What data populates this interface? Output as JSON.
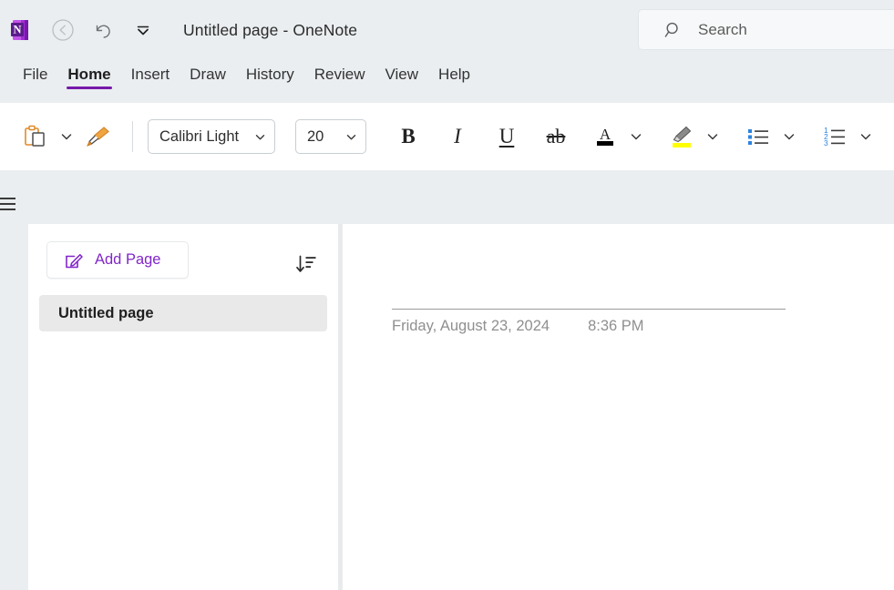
{
  "titlebar": {
    "logo_icon": "onenote-logo-icon",
    "back_icon": "back-arrow-icon",
    "undo_icon": "undo-icon",
    "qat_icon": "customize-quick-access-toolbar-icon",
    "document_name": "Untitled page",
    "separator": "-",
    "app_name": "OneNote"
  },
  "search": {
    "icon": "search-icon",
    "placeholder": "Search",
    "value": ""
  },
  "ribbon": {
    "tabs": [
      {
        "label": "File",
        "active": false
      },
      {
        "label": "Home",
        "active": true
      },
      {
        "label": "Insert",
        "active": false
      },
      {
        "label": "Draw",
        "active": false
      },
      {
        "label": "History",
        "active": false
      },
      {
        "label": "Review",
        "active": false
      },
      {
        "label": "View",
        "active": false
      },
      {
        "label": "Help",
        "active": false
      }
    ],
    "active_accent": "#7719aa"
  },
  "toolbar": {
    "paste_icon": "paste-clipboard-icon",
    "paste_caret_icon": "chevron-down-icon",
    "format_painter_icon": "format-painter-icon",
    "font_name": "Calibri Light",
    "font_name_caret_icon": "chevron-down-icon",
    "font_size": "20",
    "font_size_caret_icon": "chevron-down-icon",
    "bold_label": "B",
    "italic_label": "I",
    "underline_label": "U",
    "strikethrough_label": "ab",
    "font_color_icon": "font-color-icon",
    "font_color_swatch": "#000000",
    "font_color_caret_icon": "chevron-down-icon",
    "highlight_icon": "text-highlight-icon",
    "highlight_swatch": "#ffff00",
    "highlight_caret_icon": "chevron-down-icon",
    "bullets_icon": "bulleted-list-icon",
    "bullets_caret_icon": "chevron-down-icon",
    "numbering_icon": "numbered-list-icon",
    "numbering_caret_icon": "chevron-down-icon",
    "list_accent": "#2b83e0"
  },
  "workspace": {
    "navigation_toggle_icon": "hamburger-menu-icon"
  },
  "pagelist": {
    "add_page_icon": "compose-page-icon",
    "add_page_label": "Add Page",
    "sort_icon": "sort-pages-icon",
    "pages": [
      {
        "title": "Untitled page",
        "selected": true
      }
    ]
  },
  "canvas": {
    "page_title_value": "",
    "page_title_placeholder": "",
    "date": "Friday, August 23, 2024",
    "time": "8:36 PM"
  }
}
